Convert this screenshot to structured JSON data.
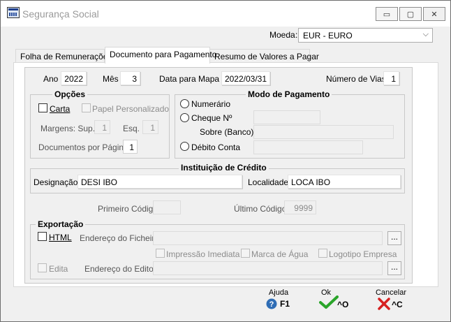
{
  "window": {
    "title": "Segurança Social",
    "minimize": "▭",
    "maximize": "▢",
    "close": "✕"
  },
  "currency": {
    "label": "Moeda",
    "value": "EUR - EURO"
  },
  "tabs": [
    {
      "label": "Folha de Remunerações"
    },
    {
      "label": "Documento para Pagamento"
    },
    {
      "label": "Resumo de Valores a Pagar"
    }
  ],
  "header": {
    "ano_label": "Ano",
    "ano_value": "2022",
    "mes_label": "Mês",
    "mes_value": "3",
    "data_label": "Data para Mapa",
    "data_value": "2022/03/31",
    "vias_label": "Número de Vias",
    "vias_value": "1"
  },
  "opcoes": {
    "title": "Opções",
    "carta": "Carta",
    "papel": "Papel Personalizado",
    "margens_label": "Margens: Sup.",
    "margens_sup": "1",
    "esq_label": "Esq.",
    "esq_value": "1",
    "docs_label": "Documentos por Página",
    "docs_value": "1"
  },
  "pagamento": {
    "title": "Modo de Pagamento",
    "numerario": "Numerário",
    "cheque": "Cheque Nº",
    "sobre": "Sobre (Banco)",
    "debito": "Débito Conta"
  },
  "instituicao": {
    "title": "Instituição de Crédito",
    "designacao_label": "Designação",
    "designacao_value": "DESI IBO",
    "localidade_label": "Localidade",
    "localidade_value": "LOCA IBO"
  },
  "codigos": {
    "primeiro_label": "Primeiro Código",
    "primeiro_value": "",
    "ultimo_label": "Último Código",
    "ultimo_value": "9999"
  },
  "exportacao": {
    "title": "Exportação",
    "html": "HTML",
    "endereco_ficheiro": "Endereço do Ficheiro",
    "impressao": "Impressão Imediata",
    "marca": "Marca de Água",
    "logotipo": "Logotipo Empresa",
    "edita": "Edita",
    "endereco_editor": "Endereço do Editor",
    "browse": "..."
  },
  "footer": {
    "ajuda_label": "Ajuda",
    "ajuda_key": "F1",
    "ok_label": "Ok",
    "ok_key": "^O",
    "cancelar_label": "Cancelar",
    "cancelar_key": "^C",
    "colors": {
      "help": "#2f6db5",
      "ok": "#2aa52a",
      "cancel": "#d62020"
    }
  }
}
